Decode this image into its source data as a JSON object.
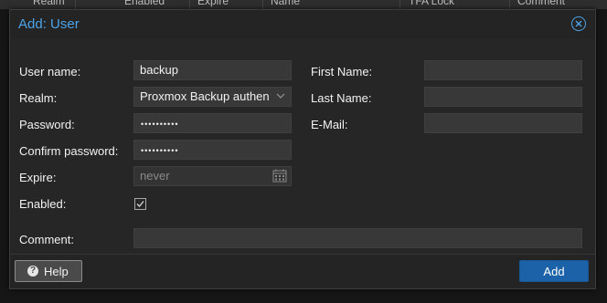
{
  "background_grid": {
    "columns": [
      "Realm",
      "Enabled",
      "Expire",
      "Name",
      "TFA Lock",
      "Comment"
    ]
  },
  "dialog": {
    "title": "Add: User",
    "close_icon": "close-circle-icon",
    "accent_color": "#4da3e8"
  },
  "form": {
    "username": {
      "label": "User name:",
      "value": "backup"
    },
    "realm": {
      "label": "Realm:",
      "value": "Proxmox Backup authen",
      "icon": "chevron-down-icon"
    },
    "password": {
      "label": "Password:",
      "value": "••••••••••"
    },
    "confirm_password": {
      "label": "Confirm password:",
      "value": "••••••••••"
    },
    "expire": {
      "label": "Expire:",
      "placeholder": "never",
      "icon": "calendar-icon"
    },
    "enabled": {
      "label": "Enabled:",
      "checked": true
    },
    "comment": {
      "label": "Comment:",
      "value": ""
    },
    "first_name": {
      "label": "First Name:",
      "value": ""
    },
    "last_name": {
      "label": "Last Name:",
      "value": ""
    },
    "email": {
      "label": "E-Mail:",
      "value": ""
    }
  },
  "footer": {
    "help_label": "Help",
    "help_icon": "question-circle-icon",
    "add_label": "Add",
    "primary_color": "#1b62a8"
  }
}
